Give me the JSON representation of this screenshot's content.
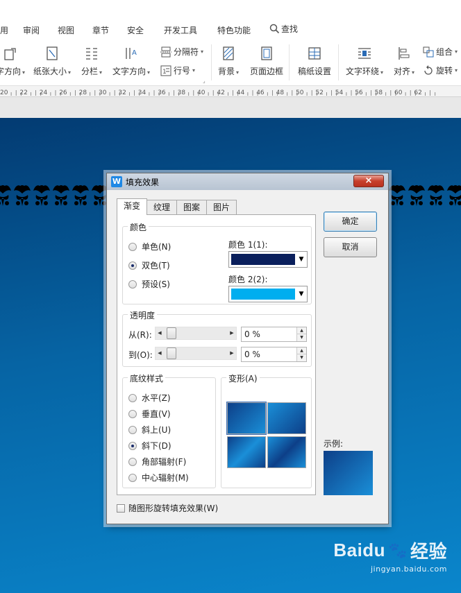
{
  "menubar": {
    "tabs": [
      "用",
      "审阅",
      "视图",
      "章节",
      "安全",
      "开发工具",
      "特色功能"
    ],
    "search_label": "查找"
  },
  "ribbon": {
    "text_direction_cut": "字方向",
    "paper_size": "纸张大小",
    "columns": "分栏",
    "text_direction": "文字方向",
    "separator": "分隔符",
    "line_number": "行号",
    "background": "背景",
    "page_border": "页面边框",
    "manuscript": "稿纸设置",
    "text_wrap": "文字环绕",
    "align": "对齐",
    "group": "组合",
    "rotate": "旋转"
  },
  "ruler": {
    "ticks": [
      "20",
      "22",
      "24",
      "26",
      "28",
      "30",
      "32",
      "34",
      "36",
      "38",
      "40",
      "42",
      "44",
      "46",
      "48",
      "50",
      "52",
      "54",
      "56",
      "58",
      "60",
      "62"
    ]
  },
  "watermark": {
    "logo": "Baidu",
    "service": "经验",
    "url": "jingyan.baidu.com"
  },
  "dialog": {
    "title": "填充效果",
    "app_icon": "W",
    "close": "×",
    "tabs": [
      "渐变",
      "纹理",
      "图案",
      "图片"
    ],
    "colors_group": {
      "title": "颜色",
      "options": [
        "单色(N)",
        "双色(T)",
        "预设(S)"
      ],
      "selected_index": 1,
      "color1_label": "颜色 1(1):",
      "color1": "#0a1f5c",
      "color2_label": "颜色 2(2):",
      "color2": "#00aeef"
    },
    "transparency_group": {
      "title": "透明度",
      "from_label": "从(R):",
      "from_value": "0 %",
      "to_label": "到(O):",
      "to_value": "0 %"
    },
    "shading_group": {
      "title": "底纹样式",
      "options": [
        "水平(Z)",
        "垂直(V)",
        "斜上(U)",
        "斜下(D)",
        "角部辐射(F)",
        "中心辐射(M)"
      ],
      "selected_index": 3
    },
    "variants_group": {
      "title": "变形(A)"
    },
    "ok": "确定",
    "cancel": "取消",
    "sample_label": "示例:",
    "rotate_checkbox": "随图形旋转填充效果(W)"
  }
}
